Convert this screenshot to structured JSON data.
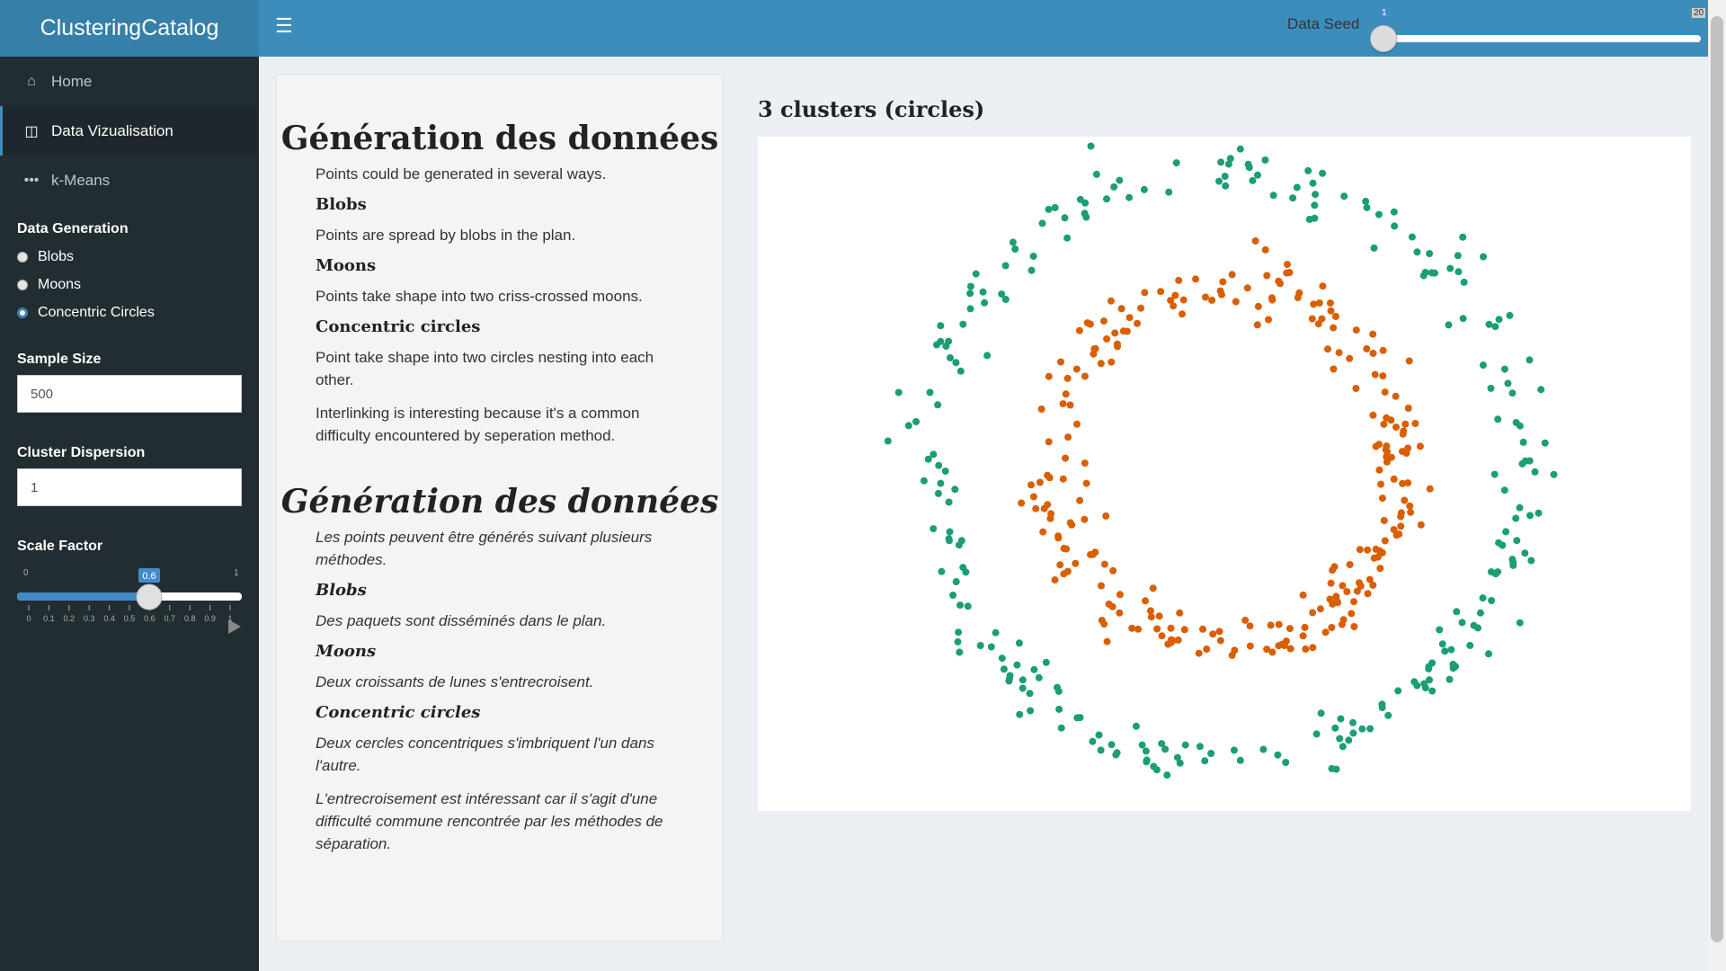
{
  "app": {
    "title": "ClusteringCatalog"
  },
  "header": {
    "seed_label": "Data Seed",
    "seed_min": "1",
    "seed_max": "20",
    "seed_value": 1
  },
  "sidebar": {
    "items": [
      {
        "label": "Home",
        "icon": "home-icon"
      },
      {
        "label": "Data Vizualisation",
        "icon": "database-icon"
      },
      {
        "label": "k-Means",
        "icon": "ellipsis-icon"
      }
    ],
    "data_generation": {
      "label": "Data Generation",
      "options": [
        "Blobs",
        "Moons",
        "Concentric Circles"
      ],
      "selected": "Concentric Circles"
    },
    "sample_size": {
      "label": "Sample Size",
      "value": "500"
    },
    "cluster_dispersion": {
      "label": "Cluster Dispersion",
      "value": "1"
    },
    "scale_factor": {
      "label": "Scale Factor",
      "min": "0",
      "max": "1",
      "value": "0.6",
      "ticks": [
        "0",
        "0.1",
        "0.2",
        "0.3",
        "0.4",
        "0.5",
        "0.6",
        "0.7",
        "0.8",
        "0.9",
        "1"
      ]
    }
  },
  "panel": {
    "en": {
      "title": "Génération des données",
      "intro": "Points could be generated in several ways.",
      "blobs_title": "Blobs",
      "blobs_text": "Points are spread by blobs in the plan.",
      "moons_title": "Moons",
      "moons_text": "Points take shape into two criss-crossed moons.",
      "circles_title": "Concentric circles",
      "circles_text": "Point take shape into two circles nesting into each other.",
      "note": "Interlinking is interesting because it's a common difficulty encountered by seperation method."
    },
    "fr": {
      "title": "Génération des données",
      "intro": "Les points peuvent être générés suivant plusieurs méthodes.",
      "blobs_title": "Blobs",
      "blobs_text": "Des paquets sont disséminés dans le plan.",
      "moons_title": "Moons",
      "moons_text": "Deux croissants de lunes s'entrecroisent.",
      "circles_title": "Concentric circles",
      "circles_text": "Deux cercles concentriques s'imbriquent l'un dans l'autre.",
      "note": "L'entrecroisement est intéressant car il s'agit d'une difficulté commune rencontrée par les méthodes de séparation."
    }
  },
  "chart_title": "3 clusters (circles)",
  "chart_data": {
    "type": "scatter",
    "title": "3 clusters (circles)",
    "xlim": [
      -1.05,
      1.05
    ],
    "ylim": [
      -1.05,
      1.05
    ],
    "grid": false,
    "series": [
      {
        "color": "#1b9e77",
        "radius": 1.0,
        "n": 250
      },
      {
        "color": "#d95f02",
        "radius": 0.6,
        "n": 250
      }
    ]
  }
}
